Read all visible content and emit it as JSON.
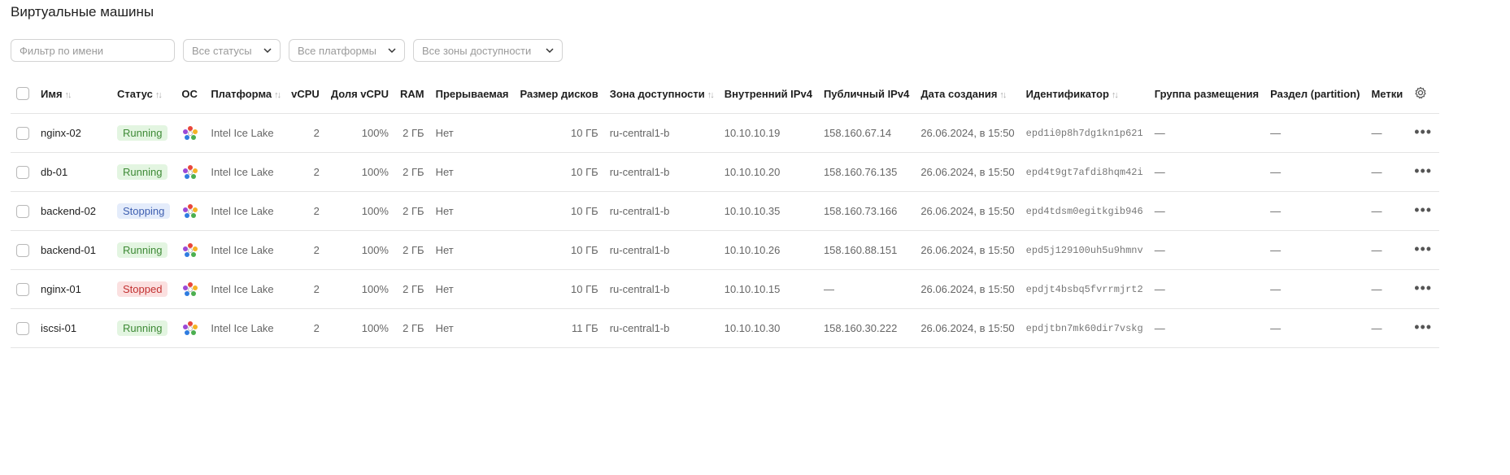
{
  "page": {
    "title": "Виртуальные машины"
  },
  "filters": {
    "search_placeholder": "Фильтр по имени",
    "status": "Все статусы",
    "platform": "Все платформы",
    "zone": "Все зоны доступности"
  },
  "table": {
    "columns": [
      "Имя",
      "Статус",
      "ОС",
      "Платформа",
      "vCPU",
      "Доля vCPU",
      "RAM",
      "Прерываемая",
      "Размер дисков",
      "Зона доступности",
      "Внутренний IPv4",
      "Публичный IPv4",
      "Дата создания",
      "Идентификатор",
      "Группа размещения",
      "Раздел (partition)",
      "Метки"
    ],
    "rows": [
      {
        "name": "nginx-02",
        "status": "Running",
        "status_kind": "running",
        "platform": "Intel Ice Lake",
        "vcpu": "2",
        "share": "100%",
        "ram": "2 ГБ",
        "preempt": "Нет",
        "disk": "10 ГБ",
        "zone": "ru-central1-b",
        "ip_int": "10.10.10.19",
        "ip_pub": "158.160.67.14",
        "created": "26.06.2024, в 15:50",
        "id": "epd1i0p8h7dg1kn1p621",
        "group": "—",
        "partition": "—",
        "labels": "—"
      },
      {
        "name": "db-01",
        "status": "Running",
        "status_kind": "running",
        "platform": "Intel Ice Lake",
        "vcpu": "2",
        "share": "100%",
        "ram": "2 ГБ",
        "preempt": "Нет",
        "disk": "10 ГБ",
        "zone": "ru-central1-b",
        "ip_int": "10.10.10.20",
        "ip_pub": "158.160.76.135",
        "created": "26.06.2024, в 15:50",
        "id": "epd4t9gt7afdi8hqm42i",
        "group": "—",
        "partition": "—",
        "labels": "—"
      },
      {
        "name": "backend-02",
        "status": "Stopping",
        "status_kind": "stopping",
        "platform": "Intel Ice Lake",
        "vcpu": "2",
        "share": "100%",
        "ram": "2 ГБ",
        "preempt": "Нет",
        "disk": "10 ГБ",
        "zone": "ru-central1-b",
        "ip_int": "10.10.10.35",
        "ip_pub": "158.160.73.166",
        "created": "26.06.2024, в 15:50",
        "id": "epd4tdsm0egitkgib946",
        "group": "—",
        "partition": "—",
        "labels": "—"
      },
      {
        "name": "backend-01",
        "status": "Running",
        "status_kind": "running",
        "platform": "Intel Ice Lake",
        "vcpu": "2",
        "share": "100%",
        "ram": "2 ГБ",
        "preempt": "Нет",
        "disk": "10 ГБ",
        "zone": "ru-central1-b",
        "ip_int": "10.10.10.26",
        "ip_pub": "158.160.88.151",
        "created": "26.06.2024, в 15:50",
        "id": "epd5j129100uh5u9hmnv",
        "group": "—",
        "partition": "—",
        "labels": "—"
      },
      {
        "name": "nginx-01",
        "status": "Stopped",
        "status_kind": "stopped",
        "platform": "Intel Ice Lake",
        "vcpu": "2",
        "share": "100%",
        "ram": "2 ГБ",
        "preempt": "Нет",
        "disk": "10 ГБ",
        "zone": "ru-central1-b",
        "ip_int": "10.10.10.15",
        "ip_pub": "—",
        "created": "26.06.2024, в 15:50",
        "id": "epdjt4bsbq5fvrrmjrt2",
        "group": "—",
        "partition": "—",
        "labels": "—"
      },
      {
        "name": "iscsi-01",
        "status": "Running",
        "status_kind": "running",
        "platform": "Intel Ice Lake",
        "vcpu": "2",
        "share": "100%",
        "ram": "2 ГБ",
        "preempt": "Нет",
        "disk": "11 ГБ",
        "zone": "ru-central1-b",
        "ip_int": "10.10.10.30",
        "ip_pub": "158.160.30.222",
        "created": "26.06.2024, в 15:50",
        "id": "epdjtbn7mk60dir7vskg",
        "group": "—",
        "partition": "—",
        "labels": "—"
      }
    ]
  },
  "icons": {
    "os": "os-logo-icon",
    "settings": "gear-icon",
    "more": "more-dots-icon",
    "sort": "sort-arrows-icon",
    "chevron": "chevron-down-icon"
  }
}
